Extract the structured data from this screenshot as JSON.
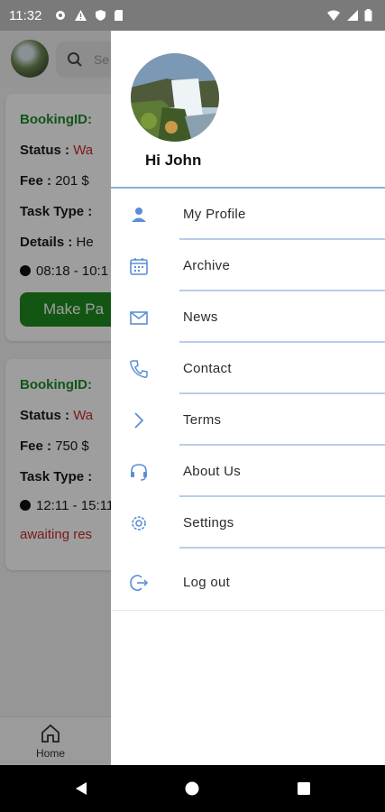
{
  "status_bar": {
    "time": "11:32",
    "left_icons": [
      "settings-icon",
      "warning-icon",
      "shield-icon",
      "sim-card-icon"
    ],
    "right_icons": [
      "wifi-icon",
      "signal-icon",
      "battery-icon"
    ]
  },
  "background_app": {
    "search_placeholder": "Se",
    "bookings": [
      {
        "id_label": "BookingID:",
        "status_label": "Status :",
        "status_value": "Wa",
        "fee_label": "Fee :",
        "fee_value": "201 $",
        "task_label": "Task Type :",
        "details_label": "Details :",
        "details_value": "He",
        "time": "08:18 - 10:1",
        "action": "Make Pa"
      },
      {
        "id_label": "BookingID:",
        "status_label": "Status :",
        "status_value": "Wa",
        "fee_label": "Fee :",
        "fee_value": "750 $",
        "task_label": "Task Type :",
        "time": "12:11 - 15:11",
        "note": "awaiting res"
      }
    ],
    "bottom_nav": {
      "home_label": "Home"
    }
  },
  "drawer": {
    "greeting": "Hi John",
    "items": [
      {
        "label": "My Profile",
        "icon": "person-icon"
      },
      {
        "label": "Archive",
        "icon": "calendar-icon"
      },
      {
        "label": "News",
        "icon": "mail-icon"
      },
      {
        "label": "Contact",
        "icon": "phone-icon"
      },
      {
        "label": "Terms",
        "icon": "chevron-right-icon"
      },
      {
        "label": "About Us",
        "icon": "headset-icon"
      },
      {
        "label": "Settings",
        "icon": "gear-icon"
      },
      {
        "label": "Log out",
        "icon": "logout-icon"
      }
    ]
  },
  "colors": {
    "accent": "#5b8ed6",
    "separator": "#b8cde9",
    "booking_green": "#1f8a2a",
    "status_red": "#c62b2b",
    "pay_button": "#1f8a1f"
  }
}
